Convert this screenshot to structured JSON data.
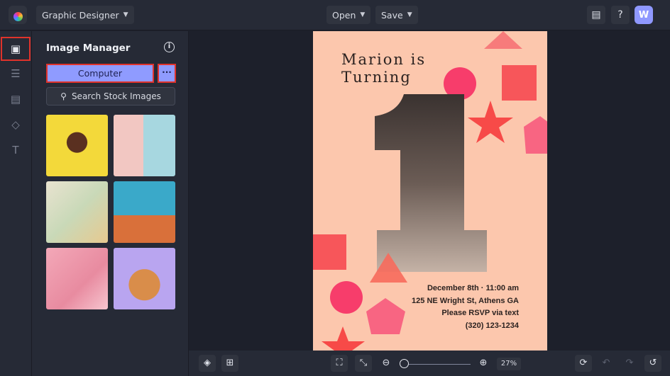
{
  "topbar": {
    "app_mode": "Graphic Designer",
    "open_label": "Open",
    "save_label": "Save",
    "avatar_initial": "W"
  },
  "panel": {
    "title": "Image Manager",
    "computer_label": "Computer",
    "more_label": "···",
    "search_label": "Search Stock Images",
    "thumbnails": [
      "woman-yellow-background",
      "pastel-doors",
      "graffiti-bicycle",
      "man-sitting-desert",
      "wedding-couple-flowers",
      "shiba-dog"
    ]
  },
  "poster": {
    "title_line1": "Marion is",
    "title_line2": "Turning",
    "date": "December 8th · 11:00 am",
    "address": "125 NE Wright St, Athens GA",
    "rsvp": "Please RSVP via text",
    "phone": "(320) 123-1234",
    "background": "#fcc7ad"
  },
  "bottombar": {
    "zoom": "27%"
  },
  "colors": {
    "accent": "#8f9bff",
    "highlight": "#e0332b"
  }
}
